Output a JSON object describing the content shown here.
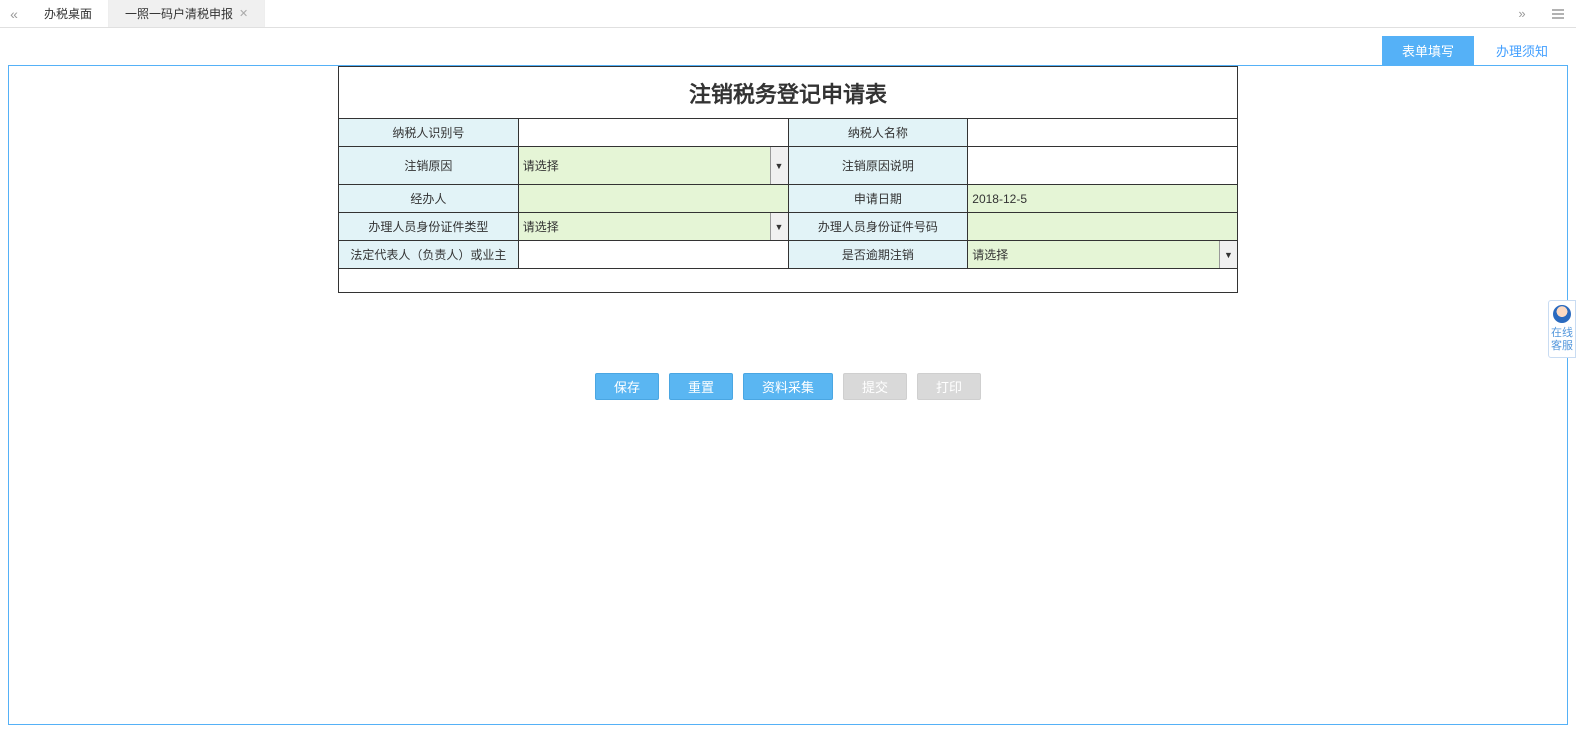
{
  "topTabs": {
    "tab1": "办税桌面",
    "tab2": "一照一码户清税申报"
  },
  "pageTabs": {
    "form": "表单填写",
    "notice": "办理须知"
  },
  "form": {
    "title": "注销税务登记申请表",
    "labels": {
      "taxpayer_id": "纳税人识别号",
      "taxpayer_name": "纳税人名称",
      "cancel_reason": "注销原因",
      "cancel_reason_desc": "注销原因说明",
      "agent": "经办人",
      "apply_date": "申请日期",
      "id_type": "办理人员身份证件类型",
      "id_number": "办理人员身份证件号码",
      "legal_rep": "法定代表人（负责人）或业主",
      "overdue": "是否逾期注销"
    },
    "values": {
      "taxpayer_id": "",
      "taxpayer_name": "",
      "cancel_reason": "请选择",
      "cancel_reason_desc": "",
      "agent": "",
      "apply_date": "2018-12-5",
      "id_type": "请选择",
      "id_number": "",
      "legal_rep": "",
      "overdue": "请选择"
    }
  },
  "buttons": {
    "save": "保存",
    "reset": "重置",
    "collect": "资料采集",
    "submit": "提交",
    "print": "打印"
  },
  "support": {
    "label": "在线客服"
  }
}
